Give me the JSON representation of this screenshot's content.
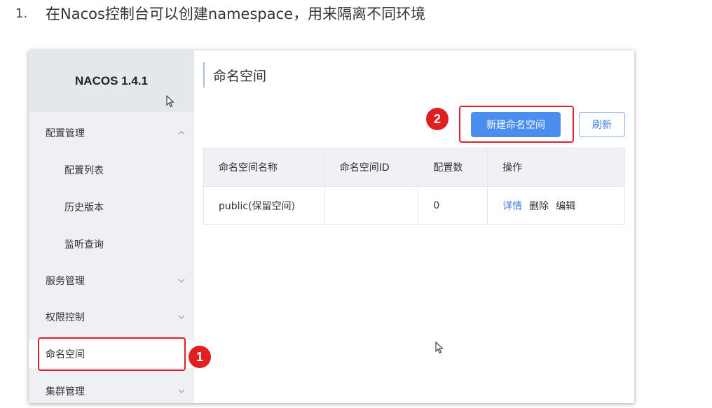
{
  "doc": {
    "step_number": "1.",
    "heading": "在Nacos控制台可以创建namespace，用来隔离不同环境"
  },
  "sidebar": {
    "brand": "NACOS 1.4.1",
    "items": [
      {
        "label": "配置管理",
        "level": 1,
        "expanded": true
      },
      {
        "label": "配置列表",
        "level": 2
      },
      {
        "label": "历史版本",
        "level": 2
      },
      {
        "label": "监听查询",
        "level": 2
      },
      {
        "label": "服务管理",
        "level": 1,
        "expanded": false
      },
      {
        "label": "权限控制",
        "level": 1,
        "expanded": false
      },
      {
        "label": "命名空间",
        "level": 1,
        "active": true
      },
      {
        "label": "集群管理",
        "level": 1,
        "expanded": false
      }
    ]
  },
  "main": {
    "title": "命名空间",
    "buttons": {
      "create": "新建命名空间",
      "refresh": "刷新"
    },
    "table": {
      "headers": [
        "命名空间名称",
        "命名空间ID",
        "配置数",
        "操作"
      ],
      "rows": [
        {
          "name": "public(保留空间)",
          "id": "",
          "count": "0",
          "ops": [
            "详情",
            "删除",
            "编辑"
          ]
        }
      ]
    }
  },
  "annotations": {
    "marker_1": "1",
    "marker_2": "2",
    "marker_color": "#e02020"
  },
  "colors": {
    "accent": "#4a8ef0",
    "sidebar_bg": "#eef0f4",
    "link": "#3b7ae0"
  }
}
